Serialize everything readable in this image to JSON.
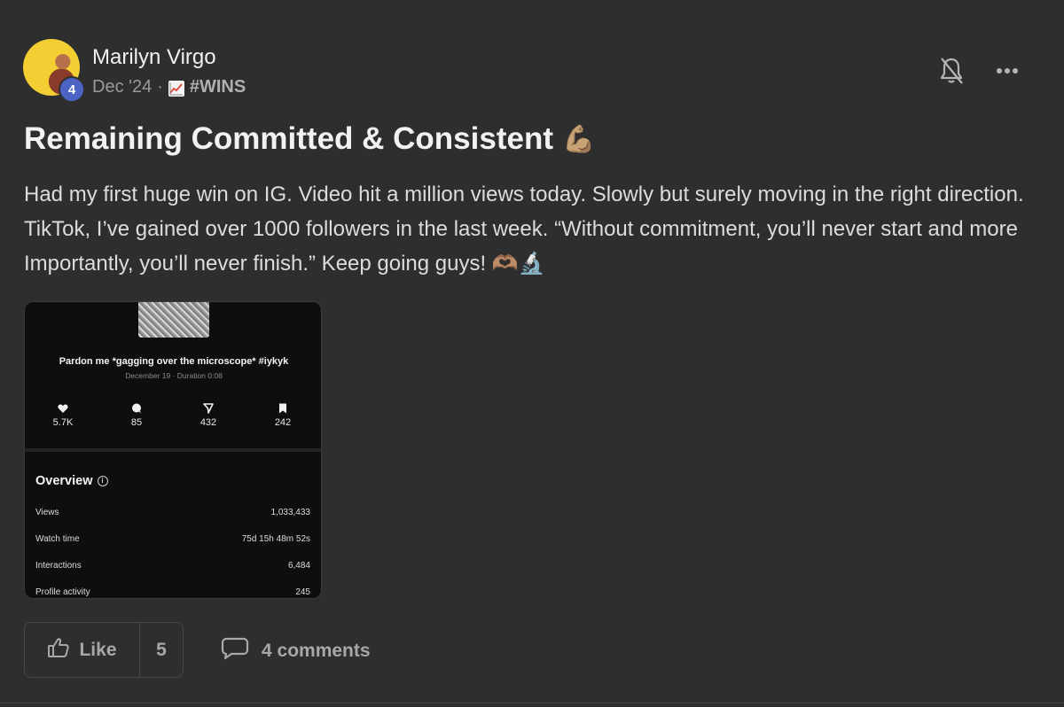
{
  "post": {
    "author": "Marilyn Virgo",
    "level": "4",
    "date": "Dec '24",
    "separator": "·",
    "category": "#WINS",
    "title": "Remaining Committed & Consistent",
    "title_emoji": "💪🏽",
    "body": "Had my first huge win on IG. Video hit a million views today. Slowly but surely moving in the right direction. TikTok, I’ve gained over 1000 followers in the last week. “Without commitment, you’ll never start and more Importantly, you’ll never finish.” Keep going guys! 🫶🏽🔬"
  },
  "screenshot": {
    "video_title": "Pardon me *gagging over the microscope* #iykyk",
    "video_sub": "December 19 · Duration 0:08",
    "stats": [
      {
        "icon": "heart-icon",
        "value": "5.7K"
      },
      {
        "icon": "comment-icon",
        "value": "85"
      },
      {
        "icon": "share-icon",
        "value": "432"
      },
      {
        "icon": "bookmark-icon",
        "value": "242"
      }
    ],
    "overview_title": "Overview",
    "overview_rows": [
      {
        "label": "Views",
        "value": "1,033,433"
      },
      {
        "label": "Watch time",
        "value": "75d 15h 48m 52s"
      },
      {
        "label": "Interactions",
        "value": "6,484"
      },
      {
        "label": "Profile activity",
        "value": "245"
      }
    ]
  },
  "actions": {
    "like_label": "Like",
    "like_count": "5",
    "comments_label": "4 comments"
  },
  "colors": {
    "background": "#2e2e2e",
    "level_badge": "#4c63c4",
    "muted_text": "#9a9a9a"
  }
}
